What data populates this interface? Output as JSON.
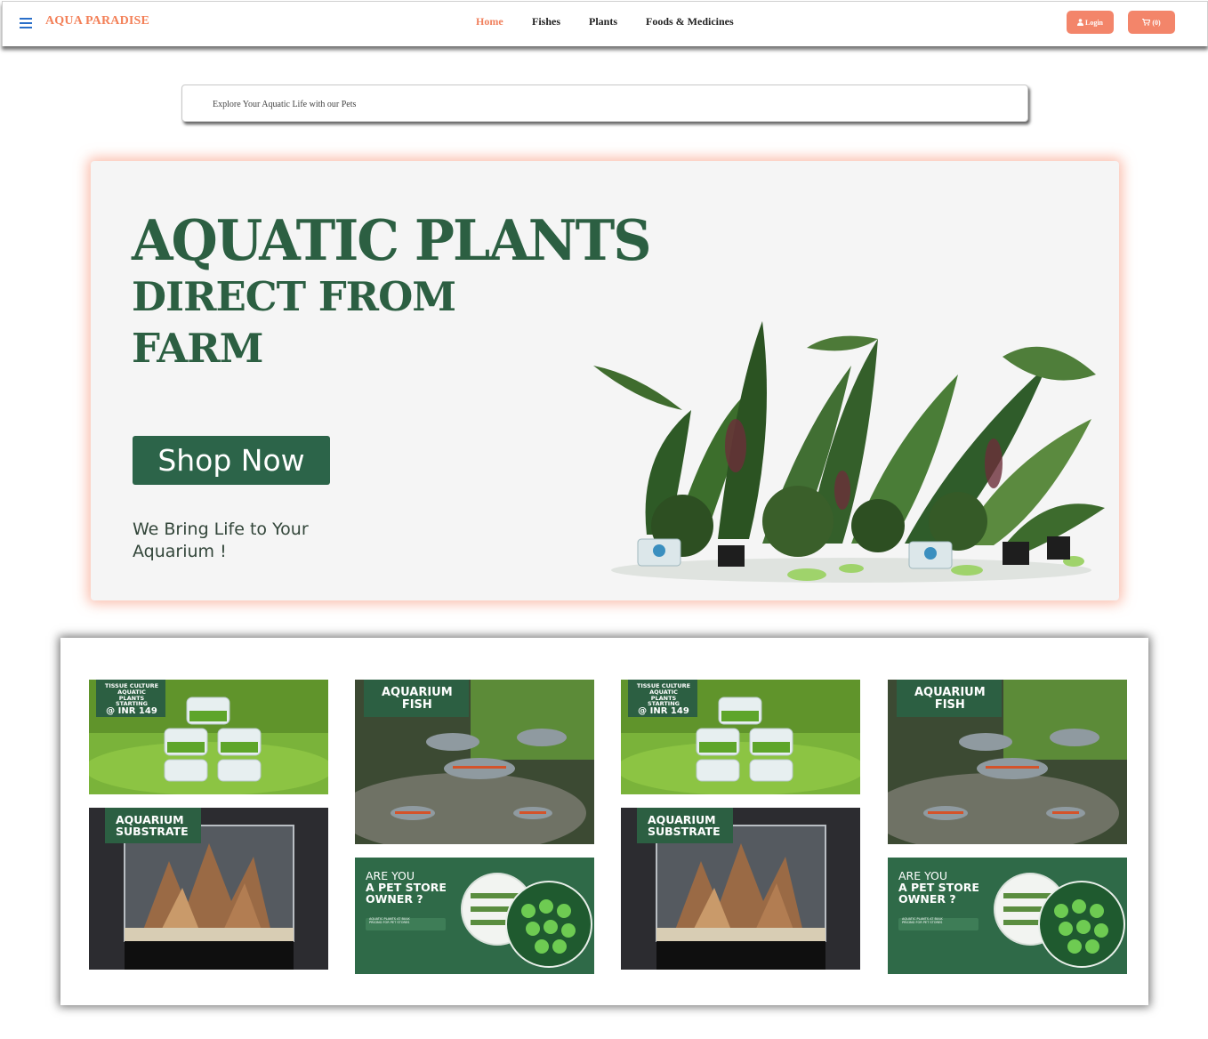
{
  "brand": "AQUA PARADISE",
  "nav": {
    "links": [
      "Home",
      "Fishes",
      "Plants",
      "Foods & Medicines"
    ],
    "active": "Home",
    "login_label": "Login",
    "cart_label": "(0)"
  },
  "search": {
    "placeholder": "Explore Your Aquatic Life with our Pets"
  },
  "hero": {
    "title_line1": "AQUATIC PLANTS",
    "title_line2": "DIRECT FROM",
    "title_line3": "FARM",
    "cta_label": "Shop Now",
    "tagline": "We Bring Life to Your Aquarium !"
  },
  "gallery": {
    "tissue": {
      "line1": "TISSUE CULTURE",
      "line2": "AQUATIC PLANTS",
      "line3": "STARTING",
      "price": "@ INR 149"
    },
    "fish": {
      "line1": "AQUARIUM",
      "line2": "FISH"
    },
    "substrate": {
      "line1": "AQUARIUM",
      "line2": "SUBSTRATE"
    },
    "owner": {
      "line1": "ARE YOU",
      "line2": "A PET STORE",
      "line3": "OWNER ?",
      "small1": "AQUATIC PLANTS AT BULK",
      "small2": "PRICING FOR PET STORES"
    }
  },
  "colors": {
    "accent": "#f3856a",
    "brand_text": "#f38058",
    "hero_green": "#2c5f42",
    "button_green": "#2c6449"
  }
}
